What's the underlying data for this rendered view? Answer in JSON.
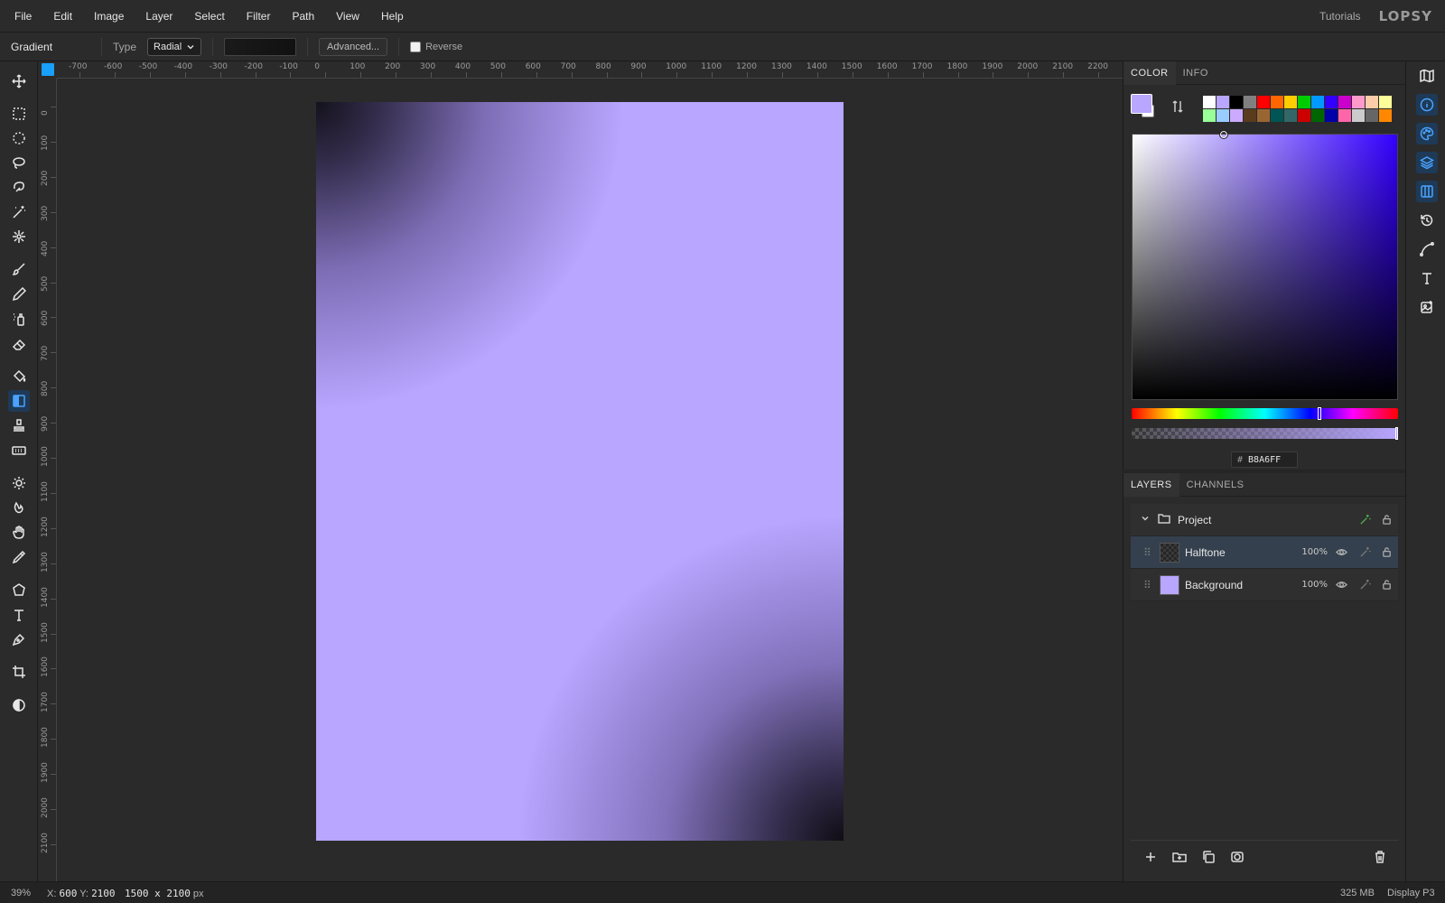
{
  "menubar": {
    "items": [
      "File",
      "Edit",
      "Image",
      "Layer",
      "Select",
      "Filter",
      "Path",
      "View",
      "Help"
    ],
    "tutorials": "Tutorials",
    "logo": "LOPSY"
  },
  "options": {
    "tool_name": "Gradient",
    "type_label": "Type",
    "type_value": "Radial",
    "advanced_label": "Advanced...",
    "reverse_label": "Reverse",
    "reverse_checked": false
  },
  "tools": [
    "move-icon",
    "rect-select-icon",
    "ellipse-select-icon",
    "lasso-icon",
    "magnetic-lasso-icon",
    "magic-wand-icon",
    "object-select-icon",
    "brush-icon",
    "pencil-icon",
    "spray-icon",
    "eraser-icon",
    "paint-bucket-icon",
    "gradient-icon",
    "stamp-icon",
    "patch-icon",
    "dodge-icon",
    "burn-icon",
    "smudge-icon",
    "eyedropper-icon",
    "polygon-icon",
    "text-tool-icon",
    "pen-icon",
    "crop-icon",
    "contrast-icon"
  ],
  "rulers": {
    "horizontal": [
      "-700",
      "-600",
      "-500",
      "-400",
      "-300",
      "-200",
      "-100",
      "0",
      "100",
      "200",
      "300",
      "400",
      "500",
      "600",
      "700",
      "800",
      "900",
      "1000",
      "1100",
      "1200",
      "1300",
      "1400",
      "1500",
      "1600",
      "1700",
      "1800",
      "1900",
      "2000",
      "2100",
      "2200"
    ],
    "vertical": [
      "0",
      "100",
      "200",
      "300",
      "400",
      "500",
      "600",
      "700",
      "800",
      "900",
      "1000",
      "1100",
      "1200",
      "1300",
      "1400",
      "1500",
      "1600",
      "1700",
      "1800",
      "1900",
      "2000",
      "2100"
    ]
  },
  "color_panel": {
    "tabs": [
      "COLOR",
      "INFO"
    ],
    "active_tab": "COLOR",
    "foreground": "#b8a6ff",
    "background": "#ffffff",
    "palette": [
      "#ffffff",
      "#b8a6ff",
      "#000000",
      "#808080",
      "#ff0000",
      "#ff6600",
      "#ffcc00",
      "#00cc00",
      "#0099ff",
      "#3300ff",
      "#cc00cc",
      "#ff99cc",
      "#ffccaa",
      "#ffff99",
      "#99ff99",
      "#99ccff",
      "#ccaaff",
      "#5a3b1e",
      "#996633",
      "#005555",
      "#336666",
      "#cc0000",
      "#006600",
      "#0000aa",
      "#ff66aa",
      "#cccccc",
      "#666666",
      "#ff8800"
    ],
    "hex_prefix": "#",
    "hex": "B8A6FF"
  },
  "layers_panel": {
    "tabs": [
      "LAYERS",
      "CHANNELS"
    ],
    "active_tab": "LAYERS",
    "group": "Project",
    "layers": [
      {
        "name": "Halftone",
        "opacity": "100%",
        "selected": true
      },
      {
        "name": "Background",
        "opacity": "100%",
        "selected": false
      }
    ]
  },
  "status": {
    "zoom": "39%",
    "x_label": "X:",
    "x": "600",
    "y_label": "Y:",
    "y": "2100",
    "size": "1500 x 2100",
    "unit": "px",
    "memory": "325 MB",
    "profile": "Display P3"
  },
  "colors": {
    "accent": "#18a0fb",
    "canvas_fill": "#b8a6ff"
  }
}
